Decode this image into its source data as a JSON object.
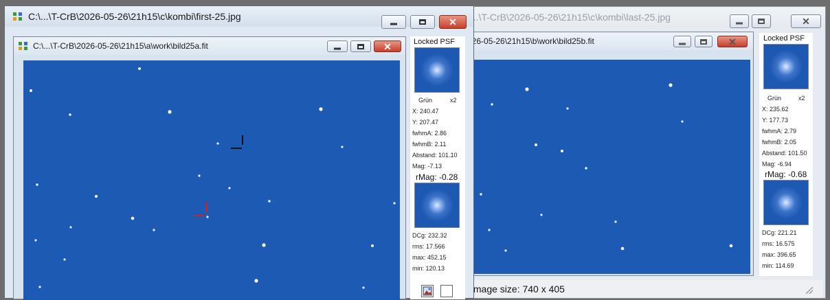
{
  "back_window": {
    "title": "C:\\...\\T-CrB\\2026-05-26\\21h15\\c\\kombi\\last-25.jpg",
    "inner_title": "C:\\...\\T-CrB\\2026-05-26\\21h15\\b\\work\\bild25b.fit",
    "psf_panel": {
      "title": "Locked PSF",
      "channel": "Grün",
      "zoom": "x2",
      "x": "X: 235.62",
      "y": "Y: 177.73",
      "fwhm_a": "fwhmA: 2.79",
      "fwhm_b": "fwhmB: 2.05",
      "abstand": "Abstand: 101.50",
      "mag": "Mag: -6.94",
      "rmag": "rMag: -0.68",
      "dcg": "DCg: 221.21",
      "rms": "rms: 16.575",
      "max": "max: 396.65",
      "min": "min: 114.69"
    },
    "status": "Image size: 740 x 405"
  },
  "front_window": {
    "title": "C:\\...\\T-CrB\\2026-05-26\\21h15\\c\\kombi\\first-25.jpg",
    "inner_title": "C:\\...\\T-CrB\\2026-05-26\\21h15\\a\\work\\bild25a.fit",
    "psf_panel": {
      "title": "Locked PSF",
      "channel": "Grün",
      "zoom": "x2",
      "x": "X: 240.47",
      "y": "Y: 207.47",
      "fwhm_a": "fwhmA: 2.86",
      "fwhm_b": "fwhmB: 2.11",
      "abstand": "Abstand: 101.10",
      "mag": "Mag: -7.13",
      "rmag": "rMag: -0.28",
      "dcg": "DCg: 232.32",
      "rms": "rms: 17.566",
      "max": "max: 452.15",
      "min": "min: 120.13"
    }
  },
  "colors": {
    "sky": "#1d5ab4",
    "marker_target": "#d42020",
    "marker_comparison": "#111111",
    "close_button": "#c5402a"
  },
  "icons": [
    "app-icon",
    "minimize-icon",
    "maximize-icon",
    "close-icon",
    "resize-grip-icon",
    "image-toggle-icon",
    "checkbox-icon"
  ]
}
